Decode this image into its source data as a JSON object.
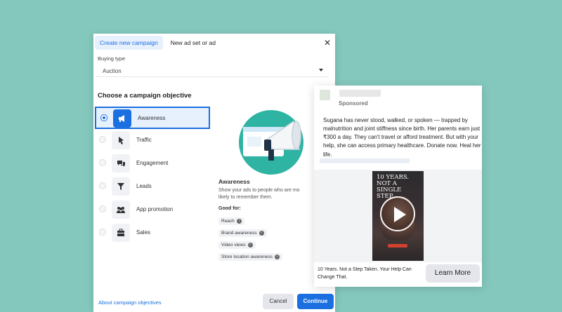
{
  "dialog": {
    "tabs": [
      "Create new campaign",
      "New ad set or ad"
    ],
    "close_glyph": "✕",
    "buying_type_label": "Buying type",
    "buying_type_value": "Auction",
    "objective_heading": "Choose a campaign objective",
    "objectives": [
      {
        "label": "Awareness",
        "icon": "megaphone-icon",
        "selected": true
      },
      {
        "label": "Traffic",
        "icon": "cursor-icon",
        "selected": false
      },
      {
        "label": "Engagement",
        "icon": "chat-bubbles-icon",
        "selected": false
      },
      {
        "label": "Leads",
        "icon": "funnel-icon",
        "selected": false
      },
      {
        "label": "App promotion",
        "icon": "people-icon",
        "selected": false
      },
      {
        "label": "Sales",
        "icon": "briefcase-icon",
        "selected": false
      }
    ],
    "detail": {
      "title": "Awareness",
      "description_line1": "Show your ads to people who are mo",
      "description_line2": "likely to remember them.",
      "good_for_label": "Good for:",
      "good_for": [
        "Reach",
        "Brand awareness",
        "Video views",
        "Store location awareness"
      ]
    },
    "footer_link": "About campaign objectives",
    "cancel_label": "Cancel",
    "continue_label": "Continue"
  },
  "ad": {
    "sponsored_label": "Sponsored",
    "body": "Sugana has never stood, walked, or spoken — trapped by malnutrition and joint stiffness since birth. Her parents earn just ₹300 a day. They can't travel or afford treatment. But with your help, she can access primary healthcare. Donate now. Heal her life.",
    "poster_text": "10 YEARS. NOT A SINGLE STEP.",
    "caption": "10 Years. Not a Step Taken. Your Help Can Change That.",
    "cta_label": "Learn More"
  },
  "colors": {
    "background": "#84c8bd",
    "accent": "#1b6fe0",
    "selected_bg": "#e7f0fd"
  }
}
